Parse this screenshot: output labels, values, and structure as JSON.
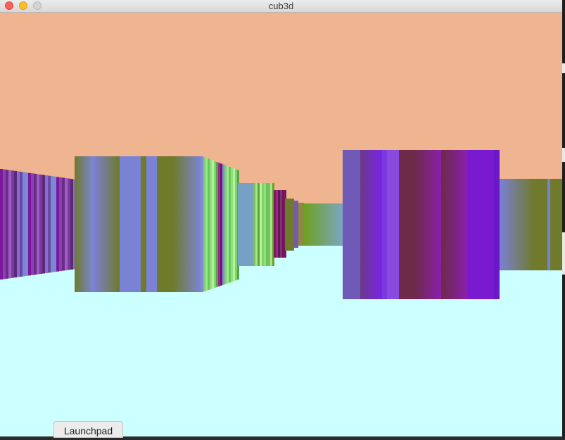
{
  "window": {
    "title": "cub3d"
  },
  "scene": {
    "ceiling_color": "#efb591",
    "floor_color": "#ccffff"
  },
  "dock": {
    "tooltip_label": "Launchpad"
  }
}
